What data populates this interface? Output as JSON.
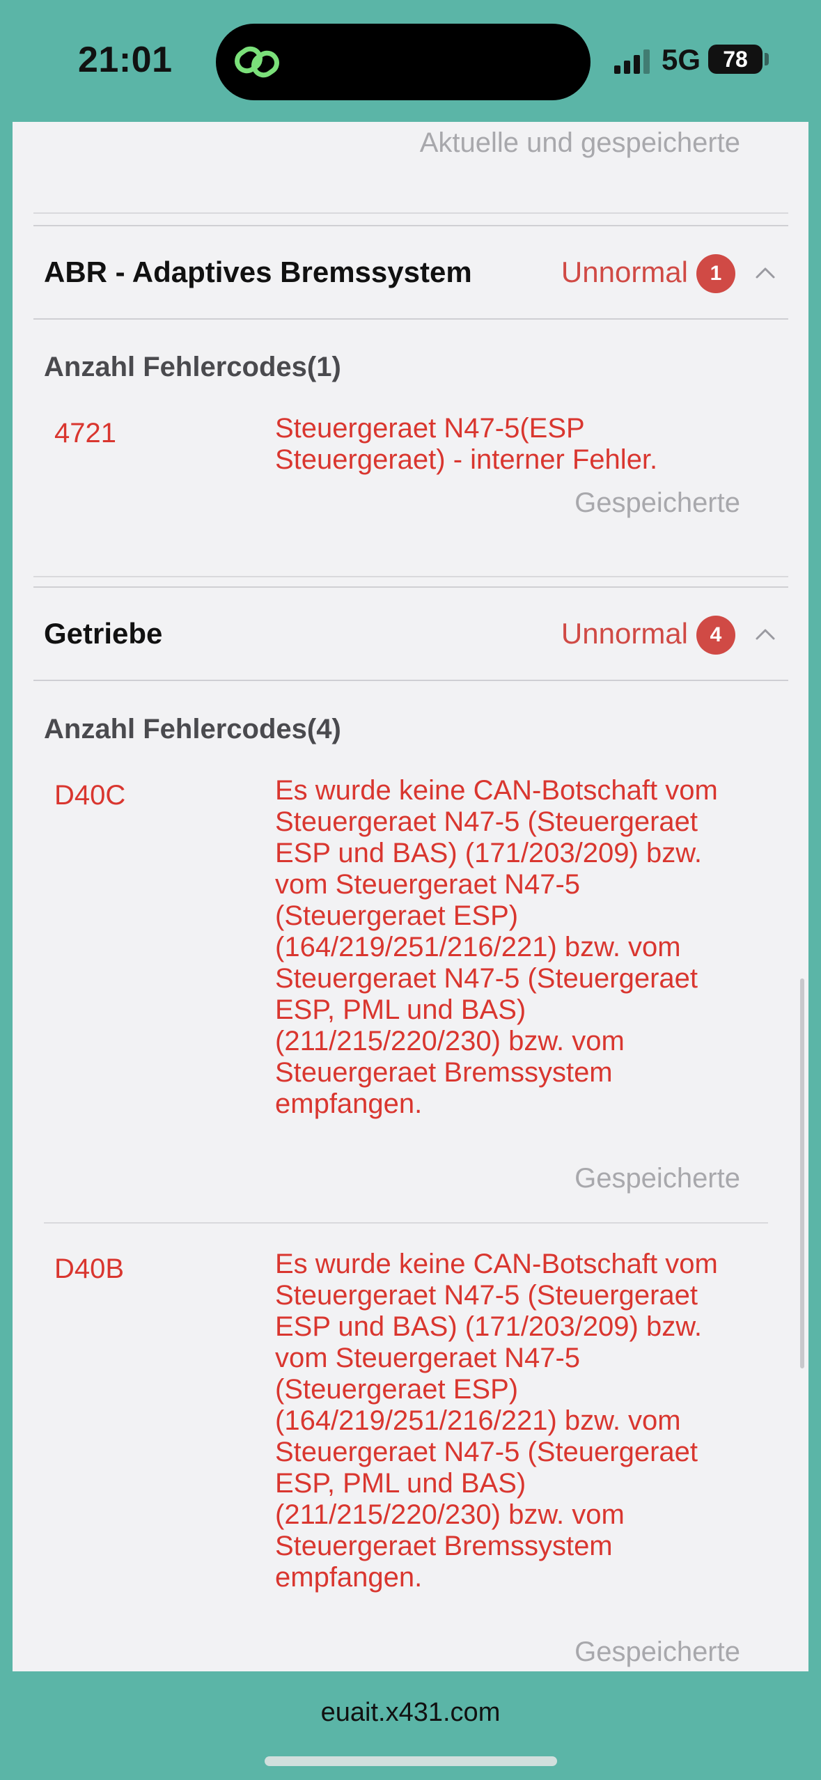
{
  "status_bar": {
    "time": "21:01",
    "network": "5G",
    "battery": "78"
  },
  "top_fault": {
    "status": "Aktuelle und gespeicherte"
  },
  "sections": [
    {
      "title": "ABR - Adaptives Bremssystem",
      "status": "Unnormal",
      "badge": "1",
      "count_label": "Anzahl Fehlercodes(1)",
      "faults": [
        {
          "code": "4721",
          "description": "Steuergeraet N47-5(ESP Steuergeraet) - interner Fehler.",
          "state": "Gespeicherte"
        }
      ]
    },
    {
      "title": "Getriebe",
      "status": "Unnormal",
      "badge": "4",
      "count_label": "Anzahl Fehlercodes(4)",
      "faults": [
        {
          "code": "D40C",
          "description": "Es wurde keine CAN-Botschaft vom Steuergeraet N47-5 (Steuergeraet ESP und BAS) (171/203/209) bzw. vom Steuergeraet N47-5 (Steuergeraet ESP) (164/219/251/216/221) bzw. vom Steuergeraet N47-5 (Steuergeraet ESP, PML und BAS) (211/215/220/230) bzw. vom Steuergeraet Bremssystem empfangen.",
          "state": "Gespeicherte"
        },
        {
          "code": "D40B",
          "description": "Es wurde keine CAN-Botschaft vom Steuergeraet N47-5 (Steuergeraet ESP und BAS) (171/203/209) bzw. vom Steuergeraet N47-5 (Steuergeraet ESP) (164/219/251/216/221) bzw. vom Steuergeraet N47-5 (Steuergeraet ESP, PML und BAS) (211/215/220/230) bzw. vom Steuergeraet Bremssystem empfangen.",
          "state": "Gespeicherte"
        }
      ]
    }
  ],
  "url_bar": {
    "url": "euait.x431.com"
  },
  "colors": {
    "frame": "#5bb5a7",
    "fault_red": "#d9362f",
    "badge_red": "#d04a45",
    "muted_gray": "#a8a8ac"
  }
}
